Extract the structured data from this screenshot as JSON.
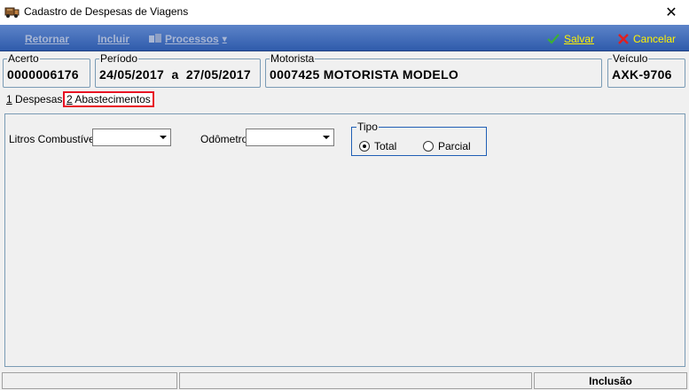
{
  "window": {
    "title": "Cadastro de Despesas de Viagens",
    "close_glyph": "✕"
  },
  "toolbar": {
    "retornar": "Retornar",
    "incluir": "Incluir",
    "processos": "Processos",
    "processos_arrow": "▾",
    "salvar": "Salvar",
    "cancelar": "Cancelar",
    "colors": {
      "bar": "#2f5bab",
      "action_text": "#fff200",
      "disabled_text": "#a8b6d3"
    }
  },
  "header": {
    "acerto": {
      "label": "Acerto",
      "value": "0000006176"
    },
    "periodo": {
      "label": "Período",
      "value": "24/05/2017  a  27/05/2017"
    },
    "motorista": {
      "label": "Motorista",
      "value": "0007425 MOTORISTA MODELO"
    },
    "veiculo": {
      "label": "Veículo",
      "value": "AXK-9706"
    }
  },
  "tabs": [
    {
      "key": "1",
      "label": " Despesas"
    },
    {
      "key": "2",
      "label": " Abastecimentos",
      "active": true
    }
  ],
  "form": {
    "litros_label": "Litros Combustível",
    "litros_value": "",
    "odometro_label": "Odômetro",
    "odometro_value": "",
    "tipo_label": "Tipo",
    "tipo_options": [
      "Total",
      "Parcial"
    ],
    "tipo_selected": "Total"
  },
  "status": {
    "mode": "Inclusão"
  }
}
